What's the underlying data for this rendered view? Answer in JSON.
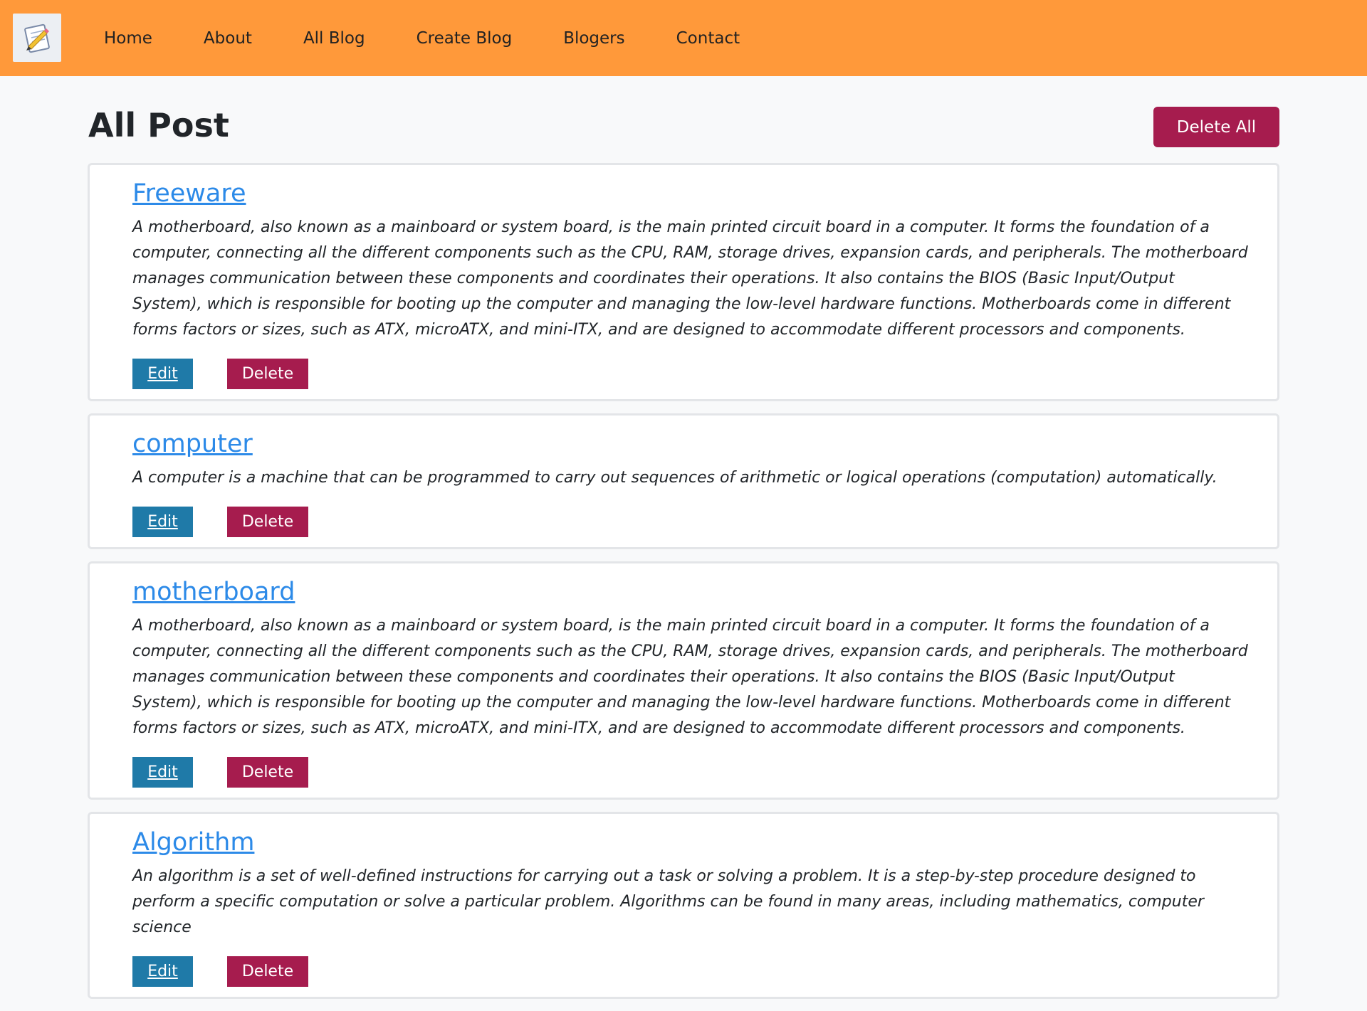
{
  "nav": {
    "logo_icon": "notepad-pencil-icon",
    "links": [
      "Home",
      "About",
      "All Blog",
      "Create Blog",
      "Blogers",
      "Contact"
    ]
  },
  "main": {
    "title": "All Post",
    "delete_all_label": "Delete All",
    "posts": [
      {
        "title": "Freeware",
        "body": "A motherboard, also known as a mainboard or system board, is the main printed circuit board in a computer. It forms the foundation of a computer, connecting all the different components such as the CPU, RAM, storage drives, expansion cards, and peripherals. The motherboard manages communication between these components and coordinates their operations. It also contains the BIOS (Basic Input/Output System), which is responsible for booting up the computer and managing the low-level hardware functions. Motherboards come in different forms factors or sizes, such as ATX, microATX, and mini-ITX, and are designed to accommodate different processors and components.",
        "edit_label": "Edit",
        "delete_label": "Delete"
      },
      {
        "title": "computer",
        "body": "A computer is a machine that can be programmed to carry out sequences of arithmetic or logical operations (computation) automatically.",
        "edit_label": "Edit",
        "delete_label": "Delete"
      },
      {
        "title": "motherboard",
        "body": "A motherboard, also known as a mainboard or system board, is the main printed circuit board in a computer. It forms the foundation of a computer, connecting all the different components such as the CPU, RAM, storage drives, expansion cards, and peripherals. The motherboard manages communication between these components and coordinates their operations. It also contains the BIOS (Basic Input/Output System), which is responsible for booting up the computer and managing the low-level hardware functions. Motherboards come in different forms factors or sizes, such as ATX, microATX, and mini-ITX, and are designed to accommodate different processors and components.",
        "edit_label": "Edit",
        "delete_label": "Delete"
      },
      {
        "title": "Algorithm",
        "body": "An algorithm is a set of well-defined instructions for carrying out a task or solving a problem. It is a step-by-step procedure designed to perform a specific computation or solve a particular problem. Algorithms can be found in many areas, including mathematics, computer science",
        "edit_label": "Edit",
        "delete_label": "Delete"
      }
    ]
  },
  "colors": {
    "navbar": "#ff993a",
    "danger": "#a61c4e",
    "edit": "#1f7aa8",
    "link": "#2c8ae8"
  }
}
